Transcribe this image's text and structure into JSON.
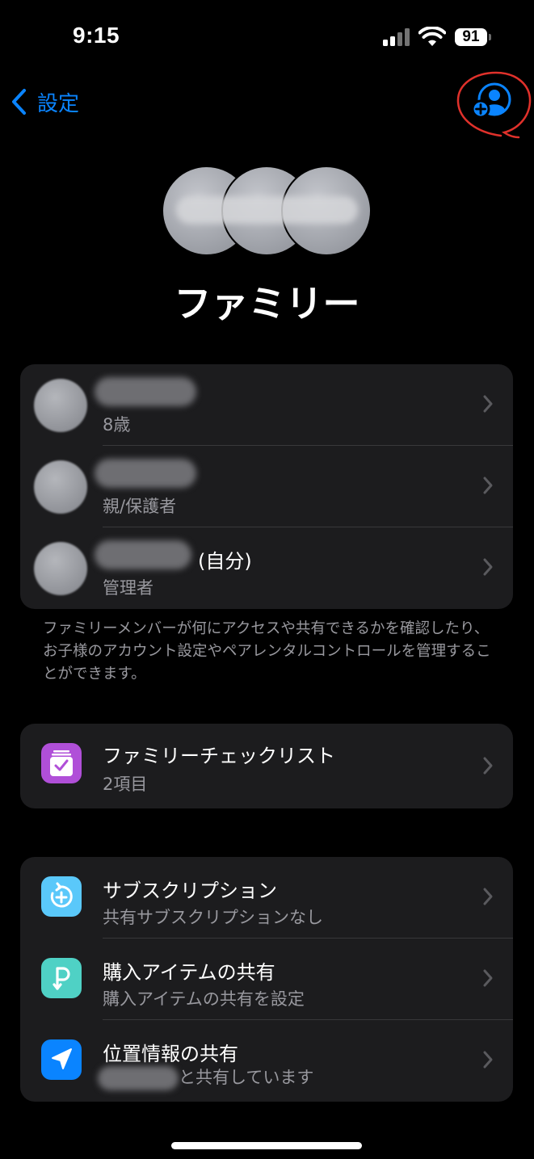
{
  "status_bar": {
    "time": "9:15",
    "battery": "91"
  },
  "nav": {
    "back_label": "設定",
    "add_member_icon": "person-plus-icon",
    "accent_color": "#0a84ff",
    "annotation_color": "#e0312b"
  },
  "header": {
    "title": "ファミリー"
  },
  "members": [
    {
      "subtitle": "8歳"
    },
    {
      "subtitle": "親/保護者"
    },
    {
      "title_suffix": "(自分)",
      "subtitle": "管理者"
    }
  ],
  "members_footnote": "ファミリーメンバーが何にアクセスや共有できるかを確認したり、お子様のアカウント設定やペアレンタルコントロールを管理することができます。",
  "checklist": {
    "title": "ファミリーチェックリスト",
    "subtitle": "2項目",
    "icon": "checklist-icon",
    "icon_color": "#b04fd8"
  },
  "sharing": [
    {
      "title": "サブスクリプション",
      "subtitle": "共有サブスクリプションなし",
      "icon": "subscription-icon",
      "icon_color": "#5ac8fa"
    },
    {
      "title": "購入アイテムの共有",
      "subtitle": "購入アイテムの共有を設定",
      "icon": "purchase-sharing-icon",
      "icon_color": "#4fd1c5"
    },
    {
      "title": "位置情報の共有",
      "subtitle": "と共有しています",
      "icon": "location-arrow-icon",
      "icon_color": "#0a84ff"
    }
  ]
}
